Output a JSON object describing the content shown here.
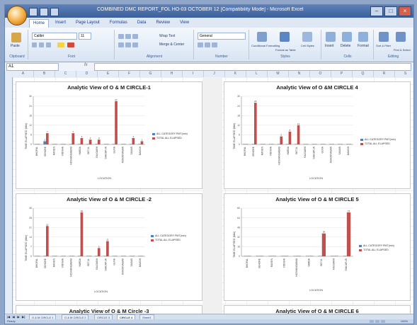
{
  "window": {
    "title": "COMBINED DMC REPORT_FOL HO-03 OCTOBER 12 [Compatibility Mode] - Microsoft Excel",
    "controls": [
      "–",
      "□",
      "×"
    ]
  },
  "ribbon": {
    "tabs": [
      "Home",
      "Insert",
      "Page Layout",
      "Formulas",
      "Data",
      "Review",
      "View"
    ],
    "active_tab": "Home",
    "font_name": "Calibri",
    "font_size": "11",
    "number_format": "General",
    "groups": [
      "Clipboard",
      "Font",
      "Alignment",
      "Number",
      "Styles",
      "Cells",
      "Editing"
    ],
    "buttons": {
      "paste": "Paste",
      "wrap_text": "Wrap Text",
      "merge_center": "Merge & Center",
      "conditional_formatting": "Conditional Formatting",
      "format_as_table": "Format as Table",
      "cell_styles": "Cell Styles",
      "insert": "Insert",
      "delete": "Delete",
      "format": "Format",
      "sort_filter": "Sort & Filter",
      "find_select": "Find & Select"
    }
  },
  "formula_bar": {
    "name_box": "A1",
    "fx": "fx",
    "formula": ""
  },
  "columns": [
    "A",
    "B",
    "C",
    "D",
    "E",
    "F",
    "G",
    "H",
    "I",
    "J",
    "K",
    "L",
    "M",
    "N",
    "O",
    "P",
    "Q",
    "R",
    "S"
  ],
  "charts": [
    {
      "title": "Analytic View of O & M CIRCLE-1",
      "xlabel": "LOCATION",
      "ylabel": "TIME ELAPSED (Min)",
      "legend": [
        "ALL CATEGORY PMT(min)",
        "TOTAL ALL ELAPSED"
      ],
      "chart_data": {
        "type": "bar",
        "categories": [
          "BHOPAL",
          "SEHORE",
          "RAISEN",
          "VIDISHA",
          "HOSHANGABAD",
          "HARDA",
          "BETUL",
          "RAJGARH",
          "SHAJAPUR",
          "GUNA",
          "ASHOKNAGAR",
          "SAGAR",
          "DAMOH"
        ],
        "ylim": [
          0,
          30
        ],
        "series": [
          {
            "name": "ALL CATEGORY PMT(min)",
            "values": [
              0,
              2,
              0,
              0,
              0,
              0,
              0,
              0,
              0,
              0,
              0,
              0,
              0
            ]
          },
          {
            "name": "TOTAL ALL ELAPSED",
            "values": [
              0,
              7,
              0,
              0,
              7,
              4,
              3,
              3,
              0,
              27,
              0,
              4,
              2
            ]
          }
        ]
      }
    },
    {
      "title": "Analytic View of O &M CIRCLE 4",
      "xlabel": "LOCATION",
      "ylabel": "TIME ELAPSED (Min)",
      "legend": [
        "ALL CATEGORY PMT(min)",
        "TOTAL ALL ELAPSED"
      ],
      "chart_data": {
        "type": "bar",
        "categories": [
          "BHOPAL",
          "SEHORE",
          "RAISEN",
          "VIDISHA",
          "HOSHANGABAD",
          "HARDA",
          "BETUL",
          "RAJGARH",
          "SHAJAPUR",
          "GUNA",
          "ASHOKNAGAR",
          "SAGAR",
          "DAMOH"
        ],
        "ylim": [
          0,
          30
        ],
        "series": [
          {
            "name": "ALL CATEGORY PMT(min)",
            "values": [
              0,
              0,
              0,
              0,
              0,
              0,
              0,
              0,
              0,
              0,
              0,
              0,
              0
            ]
          },
          {
            "name": "TOTAL ALL ELAPSED",
            "values": [
              0,
              26,
              0,
              0,
              5,
              8,
              12,
              0,
              0,
              0,
              0,
              0,
              0
            ]
          }
        ]
      }
    },
    {
      "title": "Analytic View of O & M CIRCLE -2",
      "xlabel": "LOCATION",
      "ylabel": "TIME ELAPSED (Min)",
      "legend": [
        "ALL CATEGORY PMT(min)",
        "TOTAL ALL ELAPSED"
      ],
      "chart_data": {
        "type": "bar",
        "categories": [
          "BHOPAL",
          "SEHORE",
          "RAISEN",
          "VIDISHA",
          "HOSHANGABAD",
          "HARDA",
          "BETUL",
          "RAJGARH",
          "SHAJAPUR",
          "GUNA",
          "ASHOKNAGAR",
          "SAGAR",
          "DAMOH"
        ],
        "ylim": [
          0,
          35
        ],
        "series": [
          {
            "name": "ALL CATEGORY PMT(min)",
            "values": [
              0,
              0,
              0,
              0,
              0,
              0,
              0,
              0,
              0,
              0,
              0,
              0,
              0
            ]
          },
          {
            "name": "TOTAL ALL ELAPSED",
            "values": [
              0,
              22,
              0,
              0,
              0,
              32,
              0,
              6,
              11,
              0,
              0,
              0,
              0
            ]
          }
        ]
      }
    },
    {
      "title": "Analytic View of O & M CIRCLE 5",
      "xlabel": "LOCATION",
      "ylabel": "TIME ELAPSED (Min)",
      "legend": [
        "ALL CATEGORY PMT(min)",
        "TOTAL ALL ELAPSED"
      ],
      "chart_data": {
        "type": "bar",
        "categories": [
          "BHOPAL",
          "SEHORE",
          "RAISEN",
          "VIDISHA",
          "HOSHANGABAD",
          "HARDA",
          "BETUL",
          "RAJGARH",
          "SHAJAPUR"
        ],
        "ylim": [
          0,
          80
        ],
        "series": [
          {
            "name": "ALL CATEGORY PMT(min)",
            "values": [
              0,
              0,
              0,
              0,
              0,
              0,
              0,
              0,
              0
            ]
          },
          {
            "name": "TOTAL ALL ELAPSED",
            "values": [
              0,
              0,
              0,
              0,
              0,
              0,
              38,
              0,
              73
            ]
          }
        ]
      }
    },
    {
      "title": "Analytic View of O & M Circle -3"
    },
    {
      "title": "Analytic View of O & M CIRCLE 6"
    }
  ],
  "sheet_tabs": [
    "O & M CIRCLE 1",
    "O & M CIRCLE 2",
    "CIRCLE 3",
    "CIRCLE 4",
    "Sheet1"
  ],
  "active_sheet": "CIRCLE 4",
  "status": {
    "left": "Ready",
    "zoom": "100%"
  },
  "colors": {
    "bar_primary": "#c0504d",
    "bar_secondary": "#4f81bd",
    "ribbon_bg": "#dfe7f3",
    "title_bar": "#3b5f9a"
  }
}
